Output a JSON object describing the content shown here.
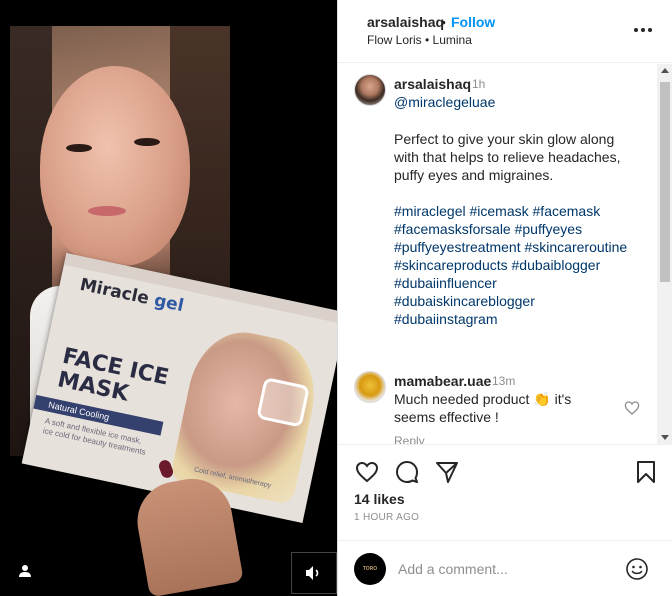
{
  "header": {
    "username": "arsalaishaq",
    "separator": "•",
    "follow_label": "Follow",
    "audio": "Flow Loris • Lumina"
  },
  "media": {
    "product_brand_a": "Miracle",
    "product_brand_b": "gel",
    "product_title": "FACE ICE MASK",
    "product_band": "Natural Cooling",
    "product_blurb": "A soft and flexible ice mask, ice cold for beauty treatments",
    "product_tag": "Cold relief, aromatherapy"
  },
  "caption": {
    "username": "arsalaishaq",
    "time": "1h",
    "mention": "@miraclegeluae",
    "body": "Perfect to give your skin glow along with that helps to relieve headaches, puffy eyes and migraines.",
    "hashtags": [
      "#miraclegel",
      "#icemask",
      "#facemask",
      "#facemasksforsale",
      "#puffyeyes",
      "#puffyeyestreatment",
      "#skincareroutine",
      "#skincareproducts",
      "#dubaiblogger",
      "#dubaiinfluencer",
      "#dubaiskincareblogger",
      "#dubaiinstagram"
    ]
  },
  "comment": {
    "username": "mamabear.uae",
    "time": "13m",
    "body": "Much needed product 👏 it's seems effective !",
    "reply_label": "Reply"
  },
  "stats": {
    "likes": "14 likes",
    "posted": "1 HOUR AGO"
  },
  "composer": {
    "placeholder": "Add a comment...",
    "avatar_text": "TORO"
  },
  "icons": {
    "like": "heart-icon",
    "comment": "comment-icon",
    "share": "paper-plane-icon",
    "save": "bookmark-icon",
    "more": "more-dots-icon",
    "emoji": "smiley-icon",
    "sound": "speaker-icon",
    "user_tag": "person-icon"
  },
  "colors": {
    "follow": "#0095f6",
    "link": "#00376b",
    "muted": "#8e8e8e",
    "text": "#262626"
  }
}
